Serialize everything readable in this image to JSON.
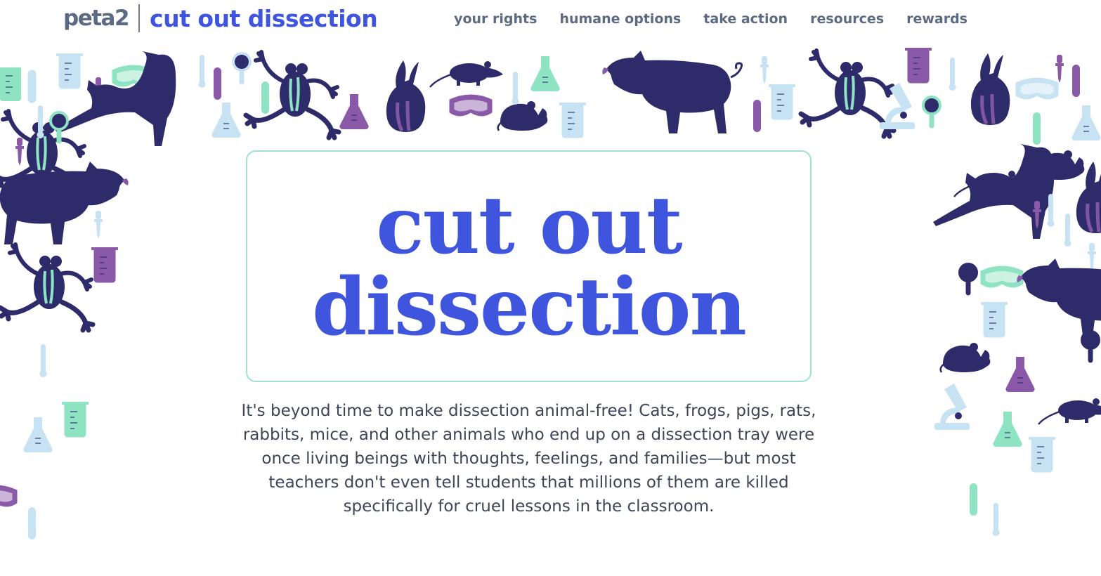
{
  "brand": {
    "org": "peta2",
    "site": "cut out dissection"
  },
  "nav": {
    "items": [
      {
        "label": "your rights"
      },
      {
        "label": "humane options"
      },
      {
        "label": "take action"
      },
      {
        "label": "resources"
      },
      {
        "label": "rewards"
      }
    ]
  },
  "hero": {
    "title_line1": "cut out",
    "title_line2": "dissection"
  },
  "intro": {
    "text": "It's beyond time to make dissection animal-free! Cats, frogs, pigs, rats, rabbits, mice, and other animals who end up on a dissection tray were once living beings with thoughts, feelings, and families—but most teachers don't even tell students that millions of them are killed specifically for cruel lessons in the classroom."
  },
  "colors": {
    "brand_blue": "#3f55dd",
    "navy_animal": "#2e2b6b",
    "purple": "#8a5aa8",
    "mint": "#8ee3c2",
    "light_blue": "#c7e3f3",
    "nav_gray": "#5c6a83"
  },
  "illustration": {
    "animals": [
      "cat-icon",
      "frog-icon",
      "pig-icon",
      "rabbit-icon",
      "rat-icon",
      "mouse-icon"
    ],
    "lab_items": [
      "beaker-icon",
      "flask-icon",
      "test-tube-icon",
      "goggles-icon",
      "magnifier-icon",
      "microscope-icon",
      "thermometer-icon",
      "dropper-icon"
    ]
  }
}
